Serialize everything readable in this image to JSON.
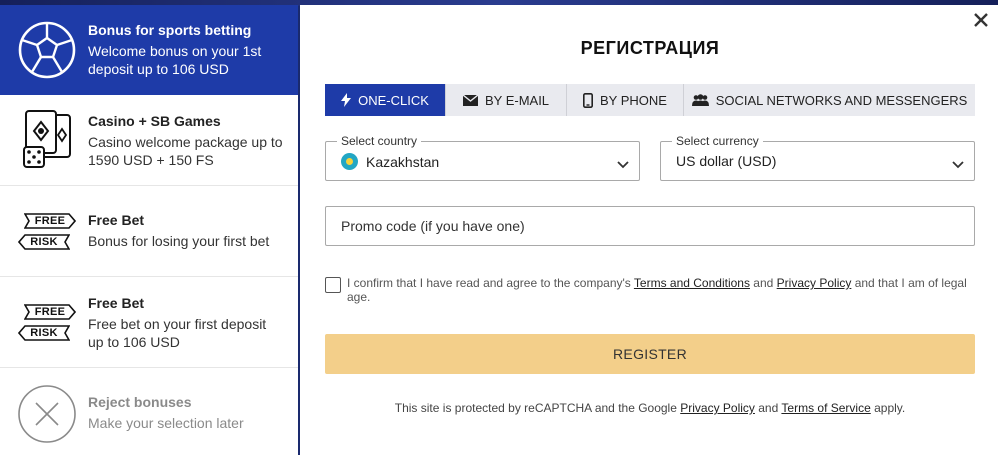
{
  "sidebar": {
    "bonuses": [
      {
        "title": "Bonus for sports betting",
        "desc": "Welcome bonus on your 1st deposit up to 106 USD",
        "icon": "soccer-ball-icon",
        "active": true
      },
      {
        "title": "Casino + SB Games",
        "desc": "Casino welcome package up to 1590 USD + 150 FS",
        "icon": "casino-cards-dice-icon"
      },
      {
        "title": "Free Bet",
        "desc": "Bonus for losing your first bet",
        "icon": "free-risk-ticket-icon",
        "tag1": "FREE",
        "tag2": "RISK"
      },
      {
        "title": "Free Bet",
        "desc": "Free bet on your first deposit up to 106 USD",
        "icon": "free-risk-ticket-icon",
        "tag1": "FREE",
        "tag2": "RISK"
      },
      {
        "title": "Reject bonuses",
        "desc": "Make your selection later",
        "icon": "reject-x-icon"
      }
    ]
  },
  "modal": {
    "title": "РЕГИСТРАЦИЯ",
    "tabs": [
      {
        "label": "ONE-CLICK",
        "icon": "lightning-icon",
        "active": true
      },
      {
        "label": "BY E-MAIL",
        "icon": "envelope-icon"
      },
      {
        "label": "BY PHONE",
        "icon": "phone-icon"
      },
      {
        "label": "SOCIAL NETWORKS AND MESSENGERS",
        "icon": "people-icon"
      }
    ],
    "country": {
      "label": "Select country",
      "value": "Kazakhstan"
    },
    "currency": {
      "label": "Select currency",
      "value": "US dollar (USD)"
    },
    "promo": {
      "placeholder": "Promo code (if you have one)"
    },
    "agree": {
      "prefix": "I confirm that I have read and agree to the company's ",
      "terms": "Terms and Conditions",
      "mid": " and ",
      "privacy": "Privacy Policy",
      "suffix": " and that I am of legal age."
    },
    "register_label": "REGISTER",
    "captcha": {
      "prefix": "This site is protected by reCAPTCHA and the Google ",
      "privacy": "Privacy Policy",
      "mid": " and ",
      "terms": "Terms of Service",
      "suffix": " apply."
    }
  },
  "colors": {
    "accent": "#1e3ba8",
    "register": "#f3cf8a"
  }
}
